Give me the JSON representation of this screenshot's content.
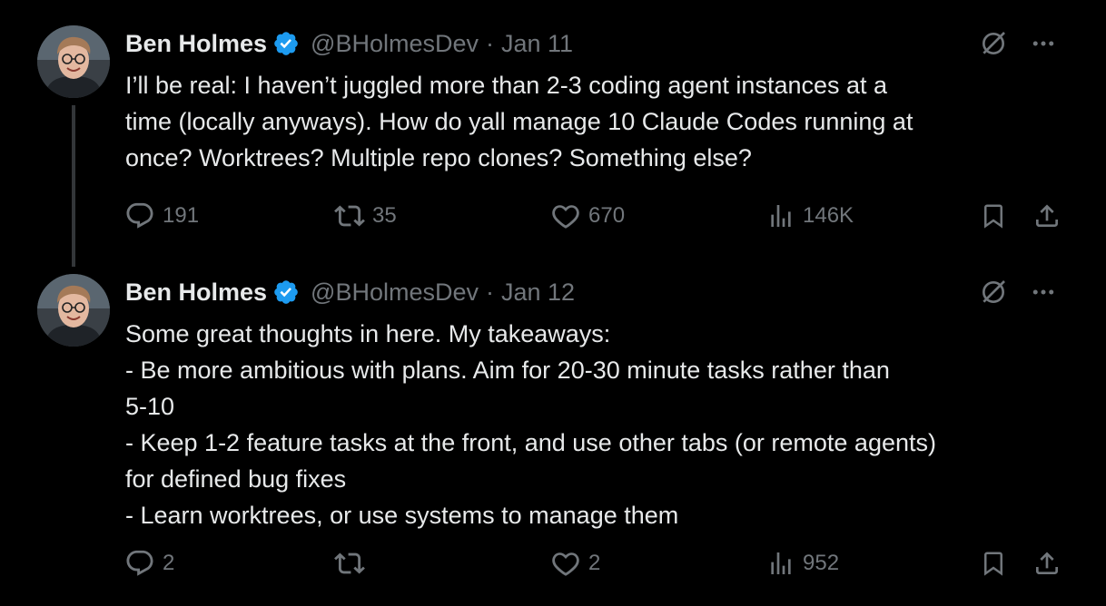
{
  "tweets": [
    {
      "author": {
        "name": "Ben Holmes",
        "handle": "@BHolmesDev"
      },
      "separator": "·",
      "date": "Jan 11",
      "text_lines": [
        "I’ll be real: I haven’t juggled more than 2-3 coding agent instances at a",
        "time (locally anyways). How do yall manage 10 Claude Codes running at",
        "once? Worktrees? Multiple repo clones? Something else?"
      ],
      "stats": {
        "replies": "191",
        "reposts": "35",
        "likes": "670",
        "views": "146K"
      }
    },
    {
      "author": {
        "name": "Ben Holmes",
        "handle": "@BHolmesDev"
      },
      "separator": "·",
      "date": "Jan 12",
      "text_lines": [
        "Some great thoughts in here. My takeaways:",
        "- Be more ambitious with plans. Aim for 20-30 minute tasks rather than",
        "5-10",
        "- Keep 1-2 feature tasks at the front, and use other tabs (or remote agents)",
        "for defined bug fixes",
        "- Learn worktrees, or use systems to manage them"
      ],
      "stats": {
        "replies": "2",
        "reposts": "",
        "likes": "2",
        "views": "952"
      }
    }
  ],
  "icons": {
    "verified": "verified-badge-icon",
    "grok": "grok-icon",
    "more": "more-icon",
    "reply": "reply-icon",
    "repost": "repost-icon",
    "like": "like-icon",
    "views": "views-icon",
    "bookmark": "bookmark-icon",
    "share": "share-icon"
  },
  "colors": {
    "background": "#000000",
    "text": "#e7e9ea",
    "muted": "#71767b",
    "verified": "#1d9bf0"
  }
}
